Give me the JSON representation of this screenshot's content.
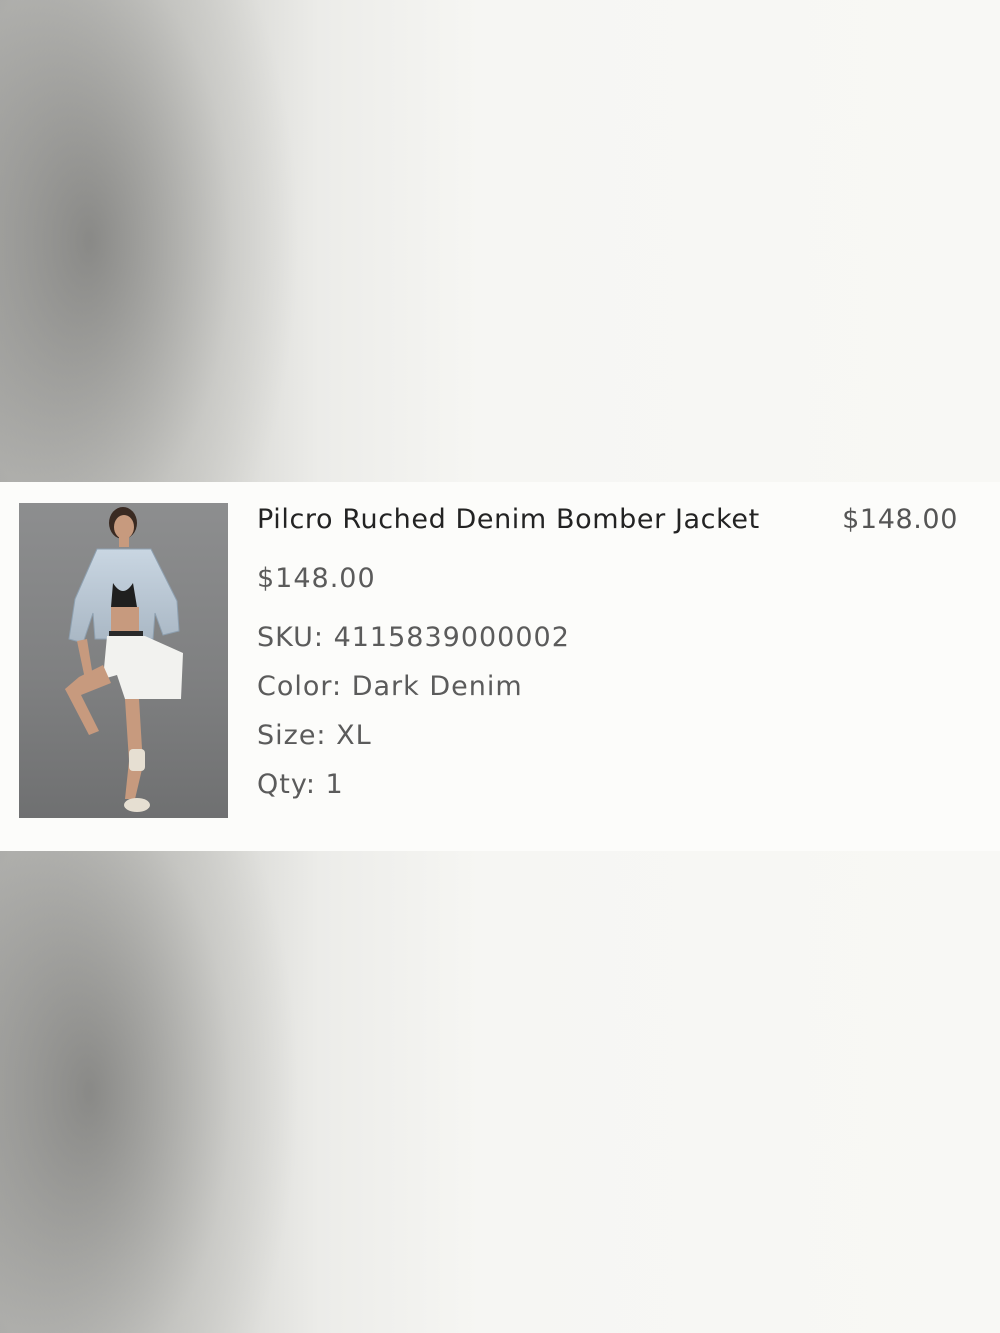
{
  "product": {
    "name": "Pilcro Ruched Denim Bomber Jacket",
    "line_total": "$148.00",
    "unit_price": "$148.00",
    "sku_label": "SKU:",
    "sku": "4115839000002",
    "color_label": "Color:",
    "color": "Dark Denim",
    "size_label": "Size:",
    "size": "XL",
    "qty_label": "Qty:",
    "qty": "1",
    "thumbnail_icon": "product-photo-icon"
  },
  "colors": {
    "card_background": "#fcfcfa",
    "title_text": "#232323",
    "meta_text": "#5b5b5b"
  }
}
